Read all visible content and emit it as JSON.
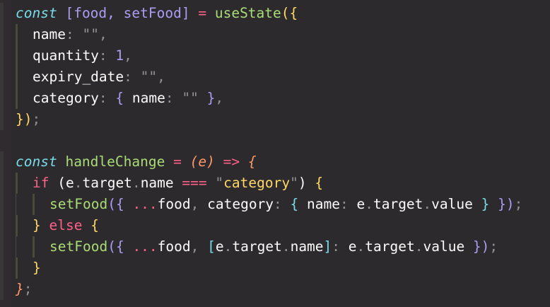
{
  "colors": {
    "background": "#2d2a2e",
    "keyword": "#78dce8",
    "function": "#a9dc76",
    "operator": "#ff6188",
    "string": "#ffd866",
    "number": "#ab9df2",
    "parameter": "#fc9867",
    "punctuation": "#939293",
    "text": "#fcfcfa"
  },
  "lines": [
    [
      {
        "t": "const",
        "c": "kw"
      },
      {
        "t": " ",
        "c": "var"
      },
      {
        "t": "[",
        "c": "br2"
      },
      {
        "t": "food",
        "c": "br2"
      },
      {
        "t": ", ",
        "c": "br2"
      },
      {
        "t": "setFood",
        "c": "br2"
      },
      {
        "t": "]",
        "c": "br2"
      },
      {
        "t": " ",
        "c": "var"
      },
      {
        "t": "=",
        "c": "op"
      },
      {
        "t": " ",
        "c": "var"
      },
      {
        "t": "useState",
        "c": "fn"
      },
      {
        "t": "(",
        "c": "br1"
      },
      {
        "t": "{",
        "c": "br1"
      }
    ],
    [
      {
        "t": "name",
        "c": "prop"
      },
      {
        "t": ": ",
        "c": "pun"
      },
      {
        "t": "\"\"",
        "c": "pun"
      },
      {
        "t": ",",
        "c": "pun"
      }
    ],
    [
      {
        "t": "quantity",
        "c": "prop"
      },
      {
        "t": ": ",
        "c": "pun"
      },
      {
        "t": "1",
        "c": "num"
      },
      {
        "t": ",",
        "c": "pun"
      }
    ],
    [
      {
        "t": "expiry_date",
        "c": "prop"
      },
      {
        "t": ": ",
        "c": "pun"
      },
      {
        "t": "\"\"",
        "c": "pun"
      },
      {
        "t": ",",
        "c": "pun"
      }
    ],
    [
      {
        "t": "category",
        "c": "prop"
      },
      {
        "t": ": ",
        "c": "pun"
      },
      {
        "t": "{",
        "c": "br2"
      },
      {
        "t": " name",
        "c": "prop"
      },
      {
        "t": ": ",
        "c": "pun"
      },
      {
        "t": "\"\"",
        "c": "pun"
      },
      {
        "t": " }",
        "c": "br2"
      },
      {
        "t": ",",
        "c": "pun"
      }
    ],
    [
      {
        "t": "}",
        "c": "br1"
      },
      {
        "t": ")",
        "c": "br1"
      },
      {
        "t": ";",
        "c": "pun"
      }
    ],
    [],
    [
      {
        "t": "const",
        "c": "kw"
      },
      {
        "t": " ",
        "c": "var"
      },
      {
        "t": "handleChange",
        "c": "fn"
      },
      {
        "t": " ",
        "c": "var"
      },
      {
        "t": "=",
        "c": "op"
      },
      {
        "t": " ",
        "c": "var"
      },
      {
        "t": "(",
        "c": "param"
      },
      {
        "t": "e",
        "c": "param"
      },
      {
        "t": ")",
        "c": "param"
      },
      {
        "t": " ",
        "c": "var"
      },
      {
        "t": "=>",
        "c": "op"
      },
      {
        "t": " ",
        "c": "var"
      },
      {
        "t": "{",
        "c": "param"
      }
    ],
    [
      {
        "t": "if",
        "c": "ctl"
      },
      {
        "t": " ",
        "c": "var"
      },
      {
        "t": "(",
        "c": "var"
      },
      {
        "t": "e",
        "c": "var"
      },
      {
        "t": ".",
        "c": "pun"
      },
      {
        "t": "target",
        "c": "var"
      },
      {
        "t": ".",
        "c": "pun"
      },
      {
        "t": "name",
        "c": "var"
      },
      {
        "t": " ",
        "c": "var"
      },
      {
        "t": "===",
        "c": "op"
      },
      {
        "t": " ",
        "c": "var"
      },
      {
        "t": "\"",
        "c": "pun"
      },
      {
        "t": "category",
        "c": "str"
      },
      {
        "t": "\"",
        "c": "pun"
      },
      {
        "t": ")",
        "c": "var"
      },
      {
        "t": " ",
        "c": "var"
      },
      {
        "t": "{",
        "c": "br1"
      }
    ],
    [
      {
        "t": "setFood",
        "c": "fn"
      },
      {
        "t": "(",
        "c": "br2"
      },
      {
        "t": "{",
        "c": "br2"
      },
      {
        "t": " ",
        "c": "var"
      },
      {
        "t": "...",
        "c": "op"
      },
      {
        "t": "food",
        "c": "var"
      },
      {
        "t": ", ",
        "c": "pun"
      },
      {
        "t": "category",
        "c": "prop"
      },
      {
        "t": ": ",
        "c": "pun"
      },
      {
        "t": "{",
        "c": "br3"
      },
      {
        "t": " name",
        "c": "prop"
      },
      {
        "t": ": ",
        "c": "pun"
      },
      {
        "t": "e",
        "c": "var"
      },
      {
        "t": ".",
        "c": "pun"
      },
      {
        "t": "target",
        "c": "var"
      },
      {
        "t": ".",
        "c": "pun"
      },
      {
        "t": "value",
        "c": "var"
      },
      {
        "t": " }",
        "c": "br3"
      },
      {
        "t": " }",
        "c": "br2"
      },
      {
        "t": ")",
        "c": "br2"
      },
      {
        "t": ";",
        "c": "pun"
      }
    ],
    [
      {
        "t": "}",
        "c": "br1"
      },
      {
        "t": " ",
        "c": "var"
      },
      {
        "t": "else",
        "c": "ctl"
      },
      {
        "t": " ",
        "c": "var"
      },
      {
        "t": "{",
        "c": "br1"
      }
    ],
    [
      {
        "t": "setFood",
        "c": "fn"
      },
      {
        "t": "(",
        "c": "br2"
      },
      {
        "t": "{",
        "c": "br2"
      },
      {
        "t": " ",
        "c": "var"
      },
      {
        "t": "...",
        "c": "op"
      },
      {
        "t": "food",
        "c": "var"
      },
      {
        "t": ", ",
        "c": "pun"
      },
      {
        "t": "[",
        "c": "br3"
      },
      {
        "t": "e",
        "c": "var"
      },
      {
        "t": ".",
        "c": "pun"
      },
      {
        "t": "target",
        "c": "var"
      },
      {
        "t": ".",
        "c": "pun"
      },
      {
        "t": "name",
        "c": "var"
      },
      {
        "t": "]",
        "c": "br3"
      },
      {
        "t": ": ",
        "c": "pun"
      },
      {
        "t": "e",
        "c": "var"
      },
      {
        "t": ".",
        "c": "pun"
      },
      {
        "t": "target",
        "c": "var"
      },
      {
        "t": ".",
        "c": "pun"
      },
      {
        "t": "value",
        "c": "var"
      },
      {
        "t": " }",
        "c": "br2"
      },
      {
        "t": ")",
        "c": "br2"
      },
      {
        "t": ";",
        "c": "pun"
      }
    ],
    [
      {
        "t": "}",
        "c": "br1"
      }
    ],
    [
      {
        "t": "}",
        "c": "param"
      },
      {
        "t": ";",
        "c": "pun"
      }
    ]
  ]
}
